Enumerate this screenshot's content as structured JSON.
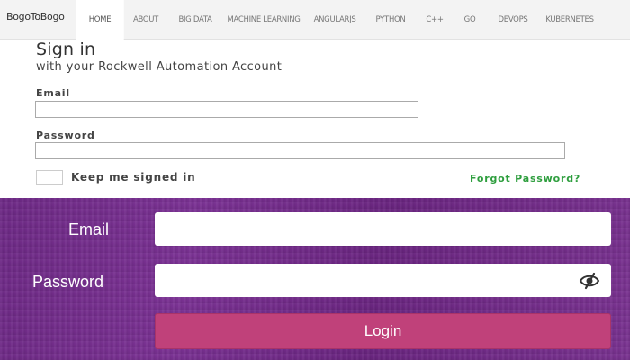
{
  "navbar": {
    "brand": "BogoToBogo",
    "items": [
      {
        "label": "HOME",
        "active": true
      },
      {
        "label": "ABOUT"
      },
      {
        "label": "BIG DATA"
      },
      {
        "label": "MACHINE LEARNING"
      },
      {
        "label": "ANGULARJS"
      },
      {
        "label": "PYTHON"
      },
      {
        "label": "C++"
      },
      {
        "label": "GO"
      },
      {
        "label": "DEVOPS"
      },
      {
        "label": "KUBERNETES"
      }
    ]
  },
  "signin": {
    "title": "Sign in",
    "subtitle": "with your Rockwell Automation Account",
    "email_label": "Email",
    "email_value": "",
    "password_label": "Password",
    "password_value": "",
    "keep_signed_in_label": "Keep me signed in",
    "keep_signed_in_checked": false,
    "forgot_password_label": "Forgot Password?"
  },
  "login_panel": {
    "email_label": "Email",
    "email_value": "",
    "password_label": "Password",
    "password_value": "",
    "password_toggle_icon": "eye-slash-icon",
    "login_button_label": "Login"
  },
  "colors": {
    "panel_purple": "#7b3294",
    "login_button": "#c0417a",
    "forgot_link": "#2e9e3e"
  }
}
